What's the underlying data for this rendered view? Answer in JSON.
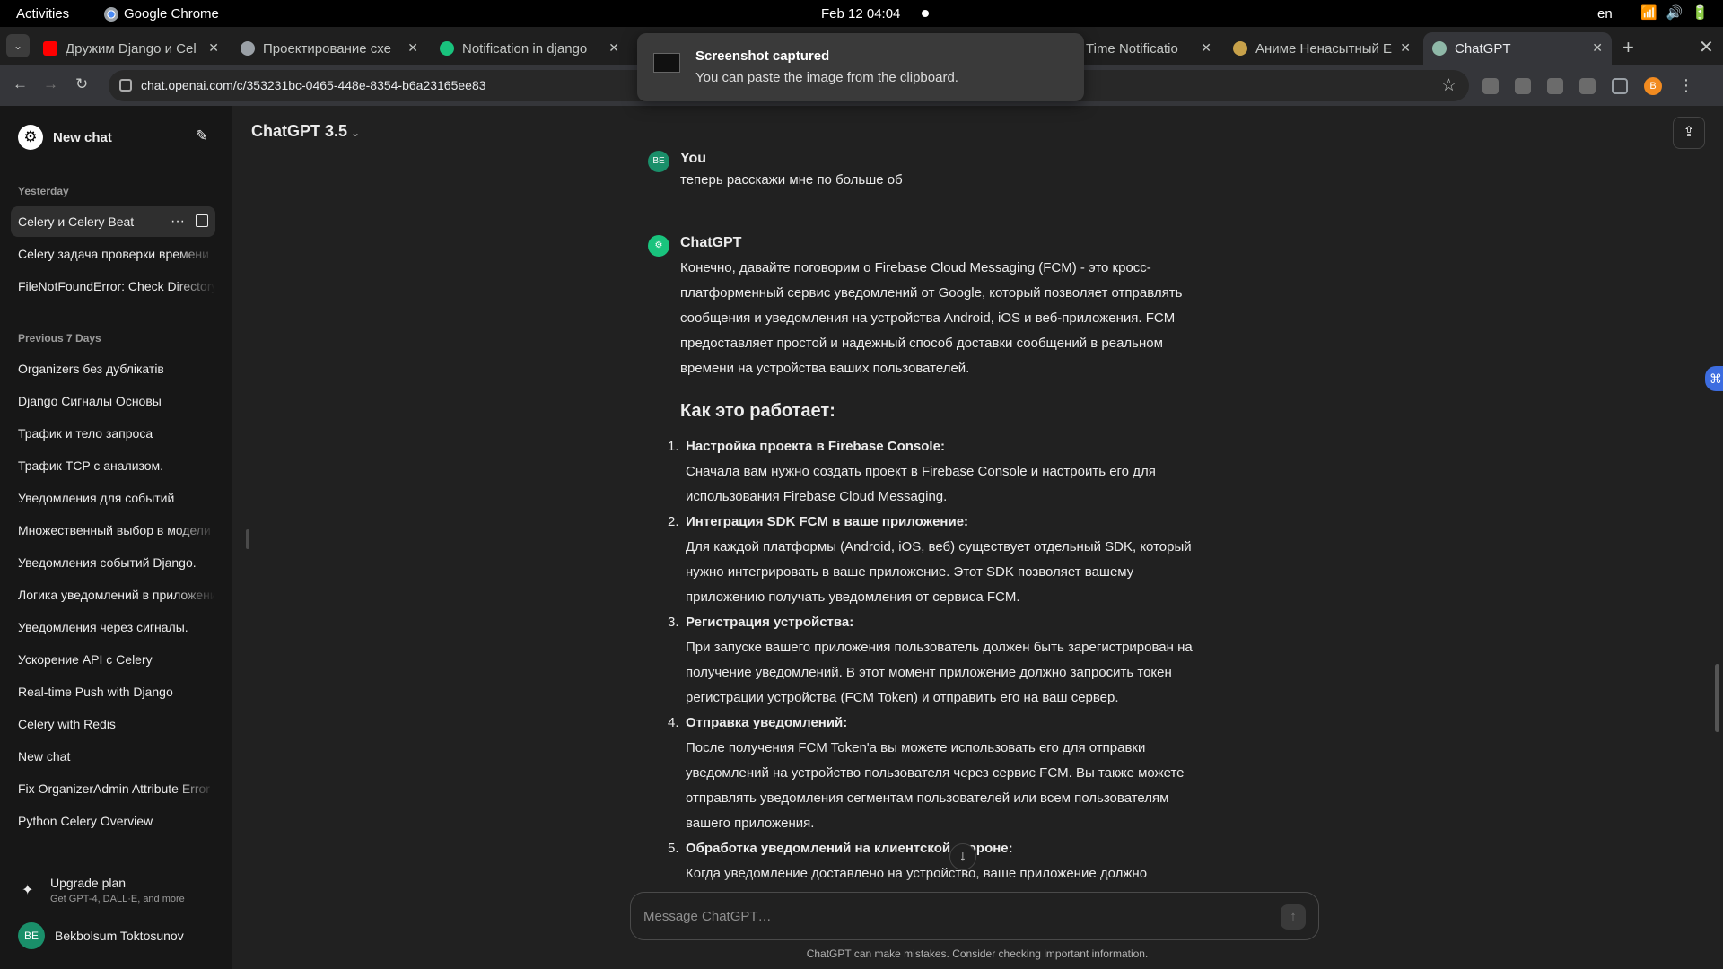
{
  "topbar": {
    "activities": "Activities",
    "app_name": "Google Chrome",
    "clock": "Feb 12  04:04",
    "lang": "en"
  },
  "tabs": [
    {
      "title": "Дружим Django и Cel",
      "favicon": "youtube-icon",
      "color": "#ff0000"
    },
    {
      "title": "Проектирование схе",
      "favicon": "globe-icon",
      "color": "#9aa0a6"
    },
    {
      "title": "Notification in django",
      "favicon": "chatgpt-icon",
      "color": "#19c37d"
    },
    {
      "title": "Time Notificatio",
      "favicon": "none",
      "color": "#9aa0a6"
    },
    {
      "title": "Аниме Ненасытный Е",
      "favicon": "anime-icon",
      "color": "#c7a14a"
    },
    {
      "title": "ChatGPT",
      "favicon": "chatgpt-icon",
      "color": "#8fb8a8"
    }
  ],
  "address": {
    "url": "chat.openai.com/c/353231bc-0465-448e-8354-b6a23165ee83"
  },
  "toast": {
    "title": "Screenshot captured",
    "message": "You can paste the image from the clipboard."
  },
  "sidebar": {
    "new_chat": "New chat",
    "sections": [
      {
        "label": "Yesterday"
      },
      {
        "label": "Previous 7 Days"
      }
    ],
    "yesterday": [
      "Celery и Celery Beat",
      "Celery задача проверки времени",
      "FileNotFoundError: Check Directory"
    ],
    "previous7": [
      "Organizers без дублікатів",
      "Django Сигналы Основы",
      "Трафик и тело запроса",
      "Трафик TCP с анализом.",
      "Уведомления для событий",
      "Множественный выбор в модели",
      "Уведомления событий Django.",
      "Логика уведомлений в приложении",
      "Уведомления через сигналы.",
      "Ускорение API с Celery",
      "Real-time Push with Django",
      "Celery with Redis",
      "New chat",
      "Fix OrganizerAdmin Attribute Error",
      "Python Celery Overview"
    ],
    "upgrade": {
      "title": "Upgrade plan",
      "subtitle": "Get GPT-4, DALL·E, and more"
    },
    "user": {
      "initials": "BE",
      "name": "Bekbolsum Toktosunov"
    }
  },
  "main": {
    "model": "ChatGPT 3.5",
    "user_author": "You",
    "user_initials": "BE",
    "user_message": "теперь расскажи мне по больше об",
    "bot_author": "ChatGPT",
    "answer_lines": [
      "Конечно, давайте поговорим о Firebase Cloud Messaging (FCM) - это кросс-",
      "платформенный сервис уведомлений от Google, который позволяет отправлять",
      "сообщения и уведомления на устройства Android, iOS и веб-приложения. FCM",
      "предоставляет простой и надежный способ доставки сообщений в реальном",
      "времени на устройства ваших пользователей."
    ],
    "heading": "Как это работает:",
    "steps": [
      {
        "num": "1.",
        "title": "Настройка проекта в Firebase Console:",
        "body": [
          "Сначала вам нужно создать проект в Firebase Console и настроить его для",
          "использования Firebase Cloud Messaging."
        ]
      },
      {
        "num": "2.",
        "title": "Интеграция SDK FCM в ваше приложение:",
        "body": [
          "Для каждой платформы (Android, iOS, веб) существует отдельный SDK, который",
          "нужно интегрировать в ваше приложение. Этот SDK позволяет вашему",
          "приложению получать уведомления от сервиса FCM."
        ]
      },
      {
        "num": "3.",
        "title": "Регистрация устройства:",
        "body": [
          "При запуске вашего приложения пользователь должен быть зарегистрирован на",
          "получение уведомлений. В этот момент приложение должно запросить токен",
          "регистрации устройства (FCM Token) и отправить его на ваш сервер."
        ]
      },
      {
        "num": "4.",
        "title": "Отправка уведомлений:",
        "body": [
          "После получения FCM Token'а вы можете использовать его для отправки",
          "уведомлений на устройство пользователя через сервис FCM. Вы также можете",
          "отправлять уведомления сегментам пользователей или всем пользователям",
          "вашего приложения."
        ]
      },
      {
        "num": "5.",
        "title": "Обработка уведомлений на клиентской стороне:",
        "body": [
          "Когда уведомление доставлено на устройство, ваше приложение должно"
        ]
      }
    ],
    "composer_placeholder": "Message ChatGPT…",
    "disclaimer": "ChatGPT can make mistakes. Consider checking important information."
  },
  "colors": {
    "accent": "#19c37d",
    "background": "#212121",
    "sidebar": "#171717"
  }
}
